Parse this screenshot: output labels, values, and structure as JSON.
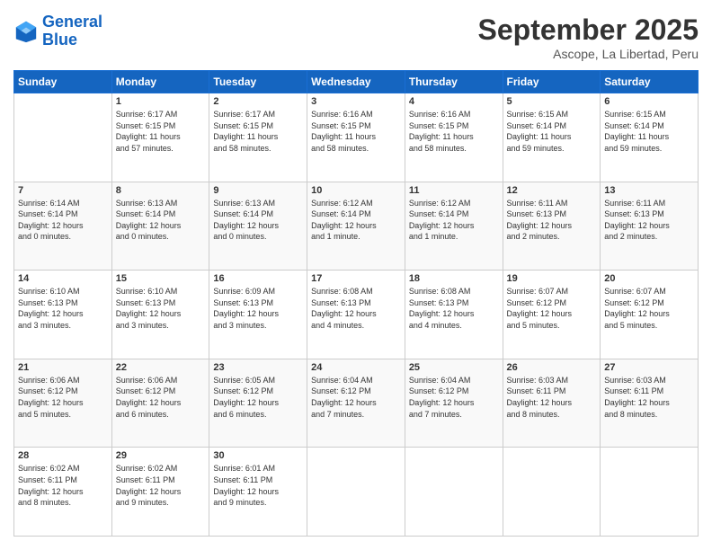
{
  "header": {
    "logo_line1": "General",
    "logo_line2": "Blue",
    "month": "September 2025",
    "location": "Ascope, La Libertad, Peru"
  },
  "weekdays": [
    "Sunday",
    "Monday",
    "Tuesday",
    "Wednesday",
    "Thursday",
    "Friday",
    "Saturday"
  ],
  "weeks": [
    [
      {
        "day": "",
        "info": ""
      },
      {
        "day": "1",
        "info": "Sunrise: 6:17 AM\nSunset: 6:15 PM\nDaylight: 11 hours\nand 57 minutes."
      },
      {
        "day": "2",
        "info": "Sunrise: 6:17 AM\nSunset: 6:15 PM\nDaylight: 11 hours\nand 58 minutes."
      },
      {
        "day": "3",
        "info": "Sunrise: 6:16 AM\nSunset: 6:15 PM\nDaylight: 11 hours\nand 58 minutes."
      },
      {
        "day": "4",
        "info": "Sunrise: 6:16 AM\nSunset: 6:15 PM\nDaylight: 11 hours\nand 58 minutes."
      },
      {
        "day": "5",
        "info": "Sunrise: 6:15 AM\nSunset: 6:14 PM\nDaylight: 11 hours\nand 59 minutes."
      },
      {
        "day": "6",
        "info": "Sunrise: 6:15 AM\nSunset: 6:14 PM\nDaylight: 11 hours\nand 59 minutes."
      }
    ],
    [
      {
        "day": "7",
        "info": "Sunrise: 6:14 AM\nSunset: 6:14 PM\nDaylight: 12 hours\nand 0 minutes."
      },
      {
        "day": "8",
        "info": "Sunrise: 6:13 AM\nSunset: 6:14 PM\nDaylight: 12 hours\nand 0 minutes."
      },
      {
        "day": "9",
        "info": "Sunrise: 6:13 AM\nSunset: 6:14 PM\nDaylight: 12 hours\nand 0 minutes."
      },
      {
        "day": "10",
        "info": "Sunrise: 6:12 AM\nSunset: 6:14 PM\nDaylight: 12 hours\nand 1 minute."
      },
      {
        "day": "11",
        "info": "Sunrise: 6:12 AM\nSunset: 6:14 PM\nDaylight: 12 hours\nand 1 minute."
      },
      {
        "day": "12",
        "info": "Sunrise: 6:11 AM\nSunset: 6:13 PM\nDaylight: 12 hours\nand 2 minutes."
      },
      {
        "day": "13",
        "info": "Sunrise: 6:11 AM\nSunset: 6:13 PM\nDaylight: 12 hours\nand 2 minutes."
      }
    ],
    [
      {
        "day": "14",
        "info": "Sunrise: 6:10 AM\nSunset: 6:13 PM\nDaylight: 12 hours\nand 3 minutes."
      },
      {
        "day": "15",
        "info": "Sunrise: 6:10 AM\nSunset: 6:13 PM\nDaylight: 12 hours\nand 3 minutes."
      },
      {
        "day": "16",
        "info": "Sunrise: 6:09 AM\nSunset: 6:13 PM\nDaylight: 12 hours\nand 3 minutes."
      },
      {
        "day": "17",
        "info": "Sunrise: 6:08 AM\nSunset: 6:13 PM\nDaylight: 12 hours\nand 4 minutes."
      },
      {
        "day": "18",
        "info": "Sunrise: 6:08 AM\nSunset: 6:13 PM\nDaylight: 12 hours\nand 4 minutes."
      },
      {
        "day": "19",
        "info": "Sunrise: 6:07 AM\nSunset: 6:12 PM\nDaylight: 12 hours\nand 5 minutes."
      },
      {
        "day": "20",
        "info": "Sunrise: 6:07 AM\nSunset: 6:12 PM\nDaylight: 12 hours\nand 5 minutes."
      }
    ],
    [
      {
        "day": "21",
        "info": "Sunrise: 6:06 AM\nSunset: 6:12 PM\nDaylight: 12 hours\nand 5 minutes."
      },
      {
        "day": "22",
        "info": "Sunrise: 6:06 AM\nSunset: 6:12 PM\nDaylight: 12 hours\nand 6 minutes."
      },
      {
        "day": "23",
        "info": "Sunrise: 6:05 AM\nSunset: 6:12 PM\nDaylight: 12 hours\nand 6 minutes."
      },
      {
        "day": "24",
        "info": "Sunrise: 6:04 AM\nSunset: 6:12 PM\nDaylight: 12 hours\nand 7 minutes."
      },
      {
        "day": "25",
        "info": "Sunrise: 6:04 AM\nSunset: 6:12 PM\nDaylight: 12 hours\nand 7 minutes."
      },
      {
        "day": "26",
        "info": "Sunrise: 6:03 AM\nSunset: 6:11 PM\nDaylight: 12 hours\nand 8 minutes."
      },
      {
        "day": "27",
        "info": "Sunrise: 6:03 AM\nSunset: 6:11 PM\nDaylight: 12 hours\nand 8 minutes."
      }
    ],
    [
      {
        "day": "28",
        "info": "Sunrise: 6:02 AM\nSunset: 6:11 PM\nDaylight: 12 hours\nand 8 minutes."
      },
      {
        "day": "29",
        "info": "Sunrise: 6:02 AM\nSunset: 6:11 PM\nDaylight: 12 hours\nand 9 minutes."
      },
      {
        "day": "30",
        "info": "Sunrise: 6:01 AM\nSunset: 6:11 PM\nDaylight: 12 hours\nand 9 minutes."
      },
      {
        "day": "",
        "info": ""
      },
      {
        "day": "",
        "info": ""
      },
      {
        "day": "",
        "info": ""
      },
      {
        "day": "",
        "info": ""
      }
    ]
  ]
}
